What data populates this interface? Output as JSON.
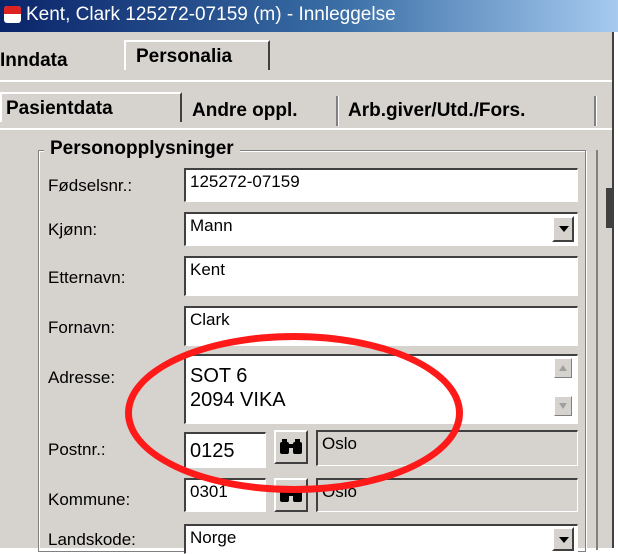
{
  "window": {
    "title": "Kent, Clark  125272-07159 (m) - Innleggelse"
  },
  "top_tabs": {
    "inndata": "Inndata",
    "personalia": "Personalia"
  },
  "sub_tabs": {
    "pasientdata": "Pasientdata",
    "andre": "Andre oppl.",
    "arbgiver": "Arb.giver/Utd./Fors."
  },
  "group": {
    "legend": "Personopplysninger"
  },
  "form": {
    "fodselsnr_label": "Fødselsnr.:",
    "fodselsnr_value": "125272-07159",
    "kjonn_label": "Kjønn:",
    "kjonn_value": "Mann",
    "etternavn_label": "Etternavn:",
    "etternavn_value": "Kent",
    "fornavn_label": "Fornavn:",
    "fornavn_value": "Clark",
    "adresse_label": "Adresse:",
    "adresse_line1": "SOT 6",
    "adresse_line2": "2094 VIKA",
    "postnr_label": "Postnr.:",
    "postnr_value": "0125",
    "poststed_value": "Oslo",
    "kommune_label": "Kommune:",
    "kommune_value": "0301",
    "kommune_name": "Oslo",
    "landskode_label": "Landskode:",
    "landskode_value": "Norge"
  },
  "annotation": {
    "color": "#ff1a1a"
  }
}
